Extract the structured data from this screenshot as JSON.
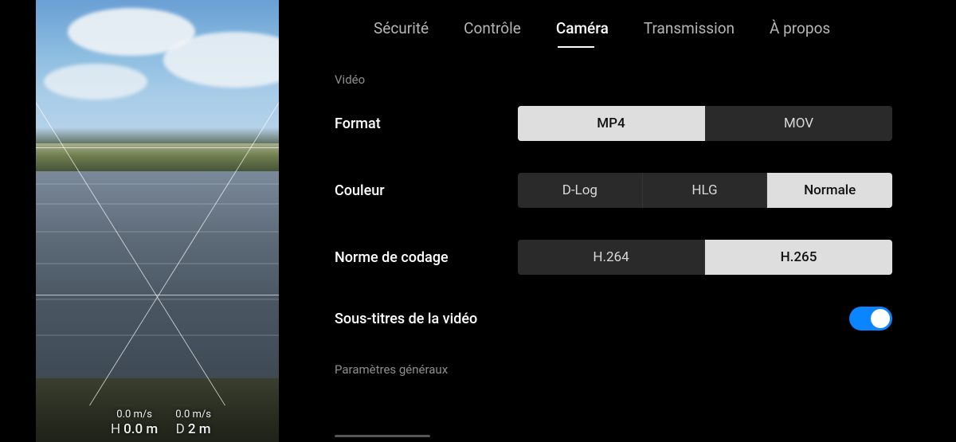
{
  "tabs": {
    "securite": "Sécurité",
    "controle": "Contrôle",
    "camera": "Caméra",
    "transmission": "Transmission",
    "apropos": "À propos",
    "active": "camera"
  },
  "video": {
    "section_label": "Vidéo",
    "format": {
      "label": "Format",
      "options": {
        "mp4": "MP4",
        "mov": "MOV"
      },
      "selected": "mp4"
    },
    "couleur": {
      "label": "Couleur",
      "options": {
        "dlog": "D-Log",
        "hlg": "HLG",
        "normale": "Normale"
      },
      "selected": "normale"
    },
    "codage": {
      "label": "Norme de codage",
      "options": {
        "h264": "H.264",
        "h265": "H.265"
      },
      "selected": "h265"
    },
    "subtitles": {
      "label": "Sous-titres de la vidéo",
      "value": true
    }
  },
  "general": {
    "section_label": "Paramètres généraux"
  },
  "osd": {
    "left": {
      "speed": "0.0 m/s",
      "letter": "H",
      "value": "0.0 m"
    },
    "right": {
      "speed": "0.0 m/s",
      "letter": "D",
      "value": "2 m"
    }
  }
}
